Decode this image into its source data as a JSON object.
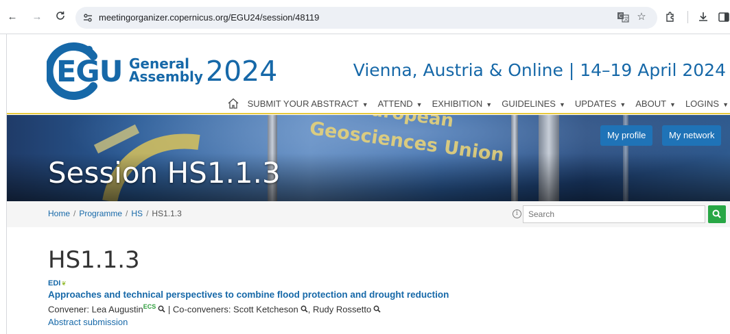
{
  "browser": {
    "url": "meetingorganizer.copernicus.org/EGU24/session/48119",
    "back_icon": "arrow-left-icon",
    "forward_icon": "arrow-right-icon",
    "reload_icon": "reload-icon",
    "right_icons": [
      "translate-icon",
      "star-icon",
      "extensions-icon",
      "download-icon",
      "sidepanel-icon"
    ]
  },
  "header": {
    "logo": {
      "egu": "EGU",
      "general": "General",
      "assembly": "Assembly",
      "year": "2024"
    },
    "venue": "Vienna, Austria & Online | 14–19 April 2024",
    "nav": [
      {
        "label": "SUBMIT YOUR ABSTRACT"
      },
      {
        "label": "ATTEND"
      },
      {
        "label": "EXHIBITION"
      },
      {
        "label": "GUIDELINES"
      },
      {
        "label": "UPDATES"
      },
      {
        "label": "ABOUT"
      },
      {
        "label": "LOGINS"
      }
    ],
    "accent_color": "#1668a8",
    "rule_color": "#e7c83a"
  },
  "banner": {
    "title": "Session HS1.1.3",
    "my_profile": "My profile",
    "my_network": "My network",
    "flag_text_1": "uropean",
    "flag_text_2": "Geosciences Union"
  },
  "breadcrumb": {
    "home": "Home",
    "programme": "Programme",
    "hs": "HS",
    "current": "HS1.1.3",
    "separator": "/"
  },
  "search": {
    "placeholder": "Search",
    "button_color": "#28a745"
  },
  "session": {
    "code": "HS1.1.3",
    "edi": "EDI",
    "title": "Approaches and technical perspectives to combine flood protection and drought reduction",
    "convener_prefix": "Convener: Lea Augustin",
    "ecs": "ECS",
    "coconveners_text": " | Co-conveners: Scott Ketcheson",
    "comma": ", Rudy Rossetto",
    "abstract_submission": "Abstract submission"
  }
}
